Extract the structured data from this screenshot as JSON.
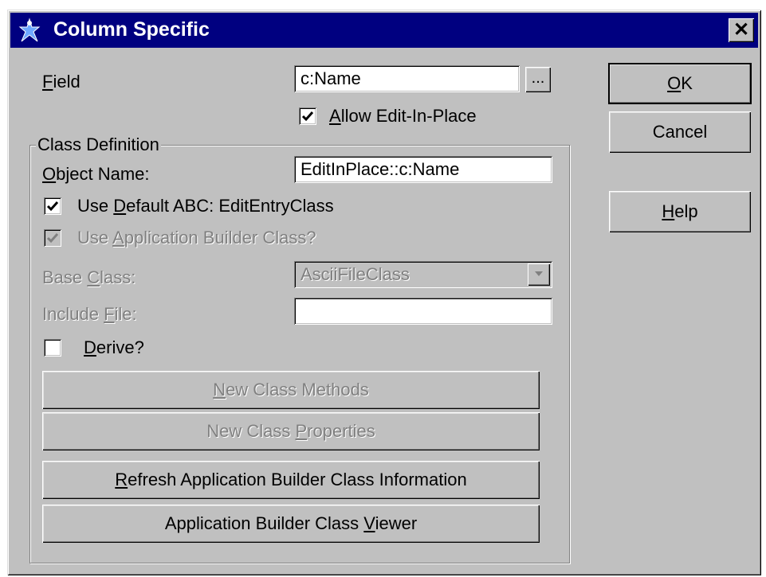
{
  "window": {
    "title": "Column Specific",
    "close_glyph": "✕"
  },
  "field": {
    "label_pre": "",
    "label_ul": "F",
    "label_post": "ield",
    "value": "c:Name",
    "browse_label": "..."
  },
  "allow_edit": {
    "checked": true,
    "label_ul": "A",
    "label_post": "llow Edit-In-Place"
  },
  "buttons": {
    "ok_ul": "O",
    "ok_post": "K",
    "cancel": "Cancel",
    "help_ul": "H",
    "help_post": "elp"
  },
  "class_definition": {
    "title": "Class Definition",
    "object_name": {
      "label_ul": "O",
      "label_post": "bject Name:",
      "value": "EditInPlace::c:Name"
    },
    "use_default": {
      "checked": true,
      "label_pre": "Use ",
      "label_ul": "D",
      "label_post": "efault ABC: EditEntryClass"
    },
    "use_app_builder": {
      "checked": true,
      "disabled": true,
      "label_pre": "Use ",
      "label_ul": "A",
      "label_post": "pplication Builder Class?"
    },
    "base_class": {
      "label_pre": "Base ",
      "label_ul": "C",
      "label_post": "lass:",
      "value": "AsciiFileClass"
    },
    "include_file": {
      "label_pre": "Include ",
      "label_ul": "F",
      "label_post": "ile:",
      "value": ""
    },
    "derive": {
      "checked": false,
      "label_ul": "D",
      "label_post": "erive?"
    },
    "new_methods": {
      "pre": "",
      "ul": "N",
      "post": "ew Class Methods"
    },
    "new_properties": {
      "pre": "New Class ",
      "ul": "P",
      "post": "roperties"
    },
    "refresh": {
      "pre": "",
      "ul": "R",
      "post": "efresh Application Builder Class Information"
    },
    "viewer": {
      "pre": "Application Builder Class ",
      "ul": "V",
      "post": "iewer"
    }
  },
  "icons": {
    "app": "clarion-figure-icon",
    "check": "checkmark-icon",
    "dropdown": "chevron-down-icon"
  },
  "colors": {
    "titlebar": "#000080",
    "face": "#c0c0c0",
    "disabled_text": "#808080"
  }
}
